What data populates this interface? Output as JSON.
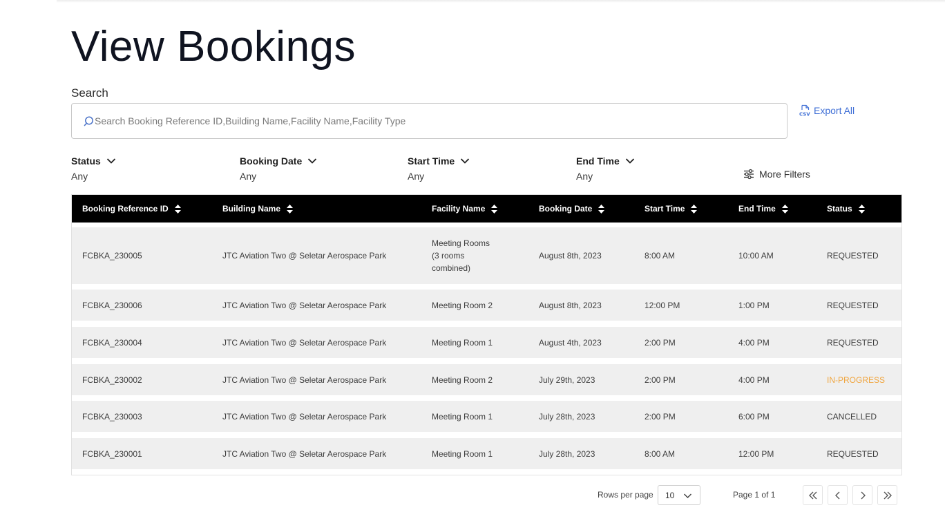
{
  "page": {
    "title": "View Bookings"
  },
  "search": {
    "label": "Search",
    "placeholder": "Search Booking Reference ID,Building Name,Facility Name,Facility Type"
  },
  "export": {
    "label": "Export All",
    "icon": "csv-file-icon"
  },
  "filters": [
    {
      "label": "Status",
      "value": "Any"
    },
    {
      "label": "Booking Date",
      "value": "Any"
    },
    {
      "label": "Start Time",
      "value": "Any"
    },
    {
      "label": "End Time",
      "value": "Any"
    }
  ],
  "more_filters": {
    "label": "More Filters",
    "icon": "sliders-icon"
  },
  "table": {
    "columns": [
      "Booking Reference ID",
      "Building Name",
      "Facility Name",
      "Booking Date",
      "Start Time",
      "End Time",
      "Status"
    ],
    "rows": [
      {
        "id": "FCBKA_230005",
        "building": "JTC Aviation Two @ Seletar Aerospace Park",
        "facility_lines": [
          "Meeting Rooms",
          "(3 rooms",
          "combined)"
        ],
        "date": "August 8th, 2023",
        "start": "8:00 AM",
        "end": "10:00 AM",
        "status": "REQUESTED"
      },
      {
        "id": "FCBKA_230006",
        "building": "JTC Aviation Two @ Seletar Aerospace Park",
        "facility_lines": [
          "Meeting Room 2"
        ],
        "date": "August 8th, 2023",
        "start": "12:00 PM",
        "end": "1:00 PM",
        "status": "REQUESTED"
      },
      {
        "id": "FCBKA_230004",
        "building": "JTC Aviation Two @ Seletar Aerospace Park",
        "facility_lines": [
          "Meeting Room 1"
        ],
        "date": "August 4th, 2023",
        "start": "2:00 PM",
        "end": "4:00 PM",
        "status": "REQUESTED"
      },
      {
        "id": "FCBKA_230002",
        "building": "JTC Aviation Two @ Seletar Aerospace Park",
        "facility_lines": [
          "Meeting Room 2"
        ],
        "date": "July 29th, 2023",
        "start": "2:00 PM",
        "end": "4:00 PM",
        "status": "IN-PROGRESS"
      },
      {
        "id": "FCBKA_230003",
        "building": "JTC Aviation Two @ Seletar Aerospace Park",
        "facility_lines": [
          "Meeting Room 1"
        ],
        "date": "July 28th, 2023",
        "start": "2:00 PM",
        "end": "6:00 PM",
        "status": "CANCELLED"
      },
      {
        "id": "FCBKA_230001",
        "building": "JTC Aviation Two @ Seletar Aerospace Park",
        "facility_lines": [
          "Meeting Room 1"
        ],
        "date": "July 28th, 2023",
        "start": "8:00 AM",
        "end": "12:00 PM",
        "status": "REQUESTED"
      }
    ]
  },
  "status_colors": {
    "IN-PROGRESS": "#f0a640",
    "default": "#3d3d3d"
  },
  "pagination": {
    "rows_per_page_label": "Rows per page",
    "rows_per_page_value": "10",
    "page_info": "Page 1 of 1"
  },
  "colors": {
    "accent": "#3f6fd6",
    "header_bg": "#000000",
    "row_bg": "#efefef"
  }
}
